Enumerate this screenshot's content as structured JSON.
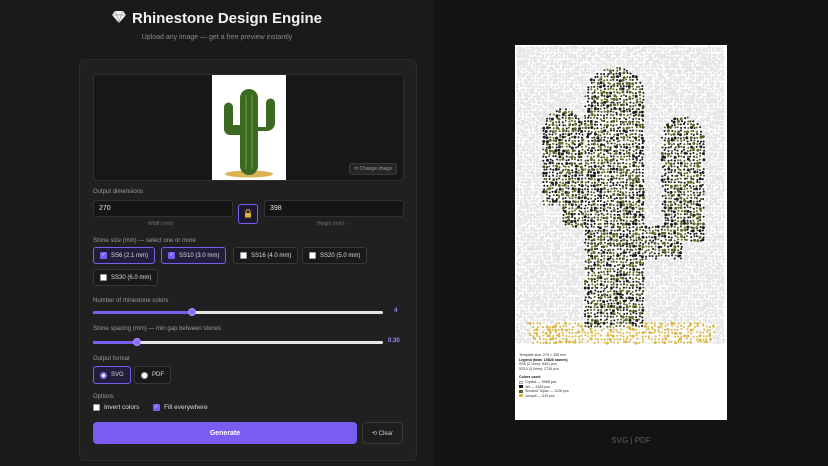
{
  "header": {
    "title": "Rhinestone Design Engine",
    "subtitle": "Upload any image — get a free preview instantly"
  },
  "upload": {
    "change_label": "⟲ Change image"
  },
  "dimensions": {
    "label": "Output dimensions",
    "width_value": "270",
    "width_hint": "Width (mm)",
    "height_value": "398",
    "height_hint": "Height (mm)"
  },
  "stone_size": {
    "label": "Stone size (mm) — select one or more",
    "options": [
      {
        "label": "SS6 (2.1 mm)",
        "checked": true
      },
      {
        "label": "SS10 (3.0 mm)",
        "checked": true
      },
      {
        "label": "SS16 (4.0 mm)",
        "checked": false
      },
      {
        "label": "SS20 (5.0 mm)",
        "checked": false
      },
      {
        "label": "SS30 (6.0 mm)",
        "checked": false
      }
    ]
  },
  "colors_slider": {
    "label": "Number of rhinestone colors",
    "value": "4",
    "fraction": 0.34
  },
  "spacing_slider": {
    "label": "Stone spacing (mm) — min gap between stones",
    "value": "0.30",
    "fraction": 0.15
  },
  "output_format": {
    "label": "Output format",
    "options": [
      "SVG",
      "PDF"
    ],
    "selected": "SVG"
  },
  "options": {
    "label": "Options",
    "invert_label": "Invert colors",
    "invert_checked": false,
    "fill_label": "Fill everywhere",
    "fill_checked": true
  },
  "actions": {
    "generate_label": "Generate",
    "clear_label": "⟲ Clear"
  },
  "preview": {
    "template_size": "Template size: 270 × 398 mm",
    "legend_title": "Legend (total: 10826 stones)",
    "sizes": [
      "SS6 (2.1mm): 8091 pcs",
      "SS10 (3.0mm): 2735 pcs"
    ],
    "colors_title": "Colors used:",
    "colors": [
      {
        "name": "Crystal — 5988 pcs",
        "color": "#e8e8e8"
      },
      {
        "name": "Jet — 3189 pcs",
        "color": "#1c1c1c"
      },
      {
        "name": "Smoked Topaz — 1128 pcs",
        "color": "#5a6a2a"
      },
      {
        "name": "Jonquil — 519 pcs",
        "color": "#d9b84a"
      }
    ],
    "formats_label": "SVG | PDF"
  },
  "colors": {
    "accent": "#7a5cf0",
    "background": "#141414",
    "panel": "#202020"
  }
}
